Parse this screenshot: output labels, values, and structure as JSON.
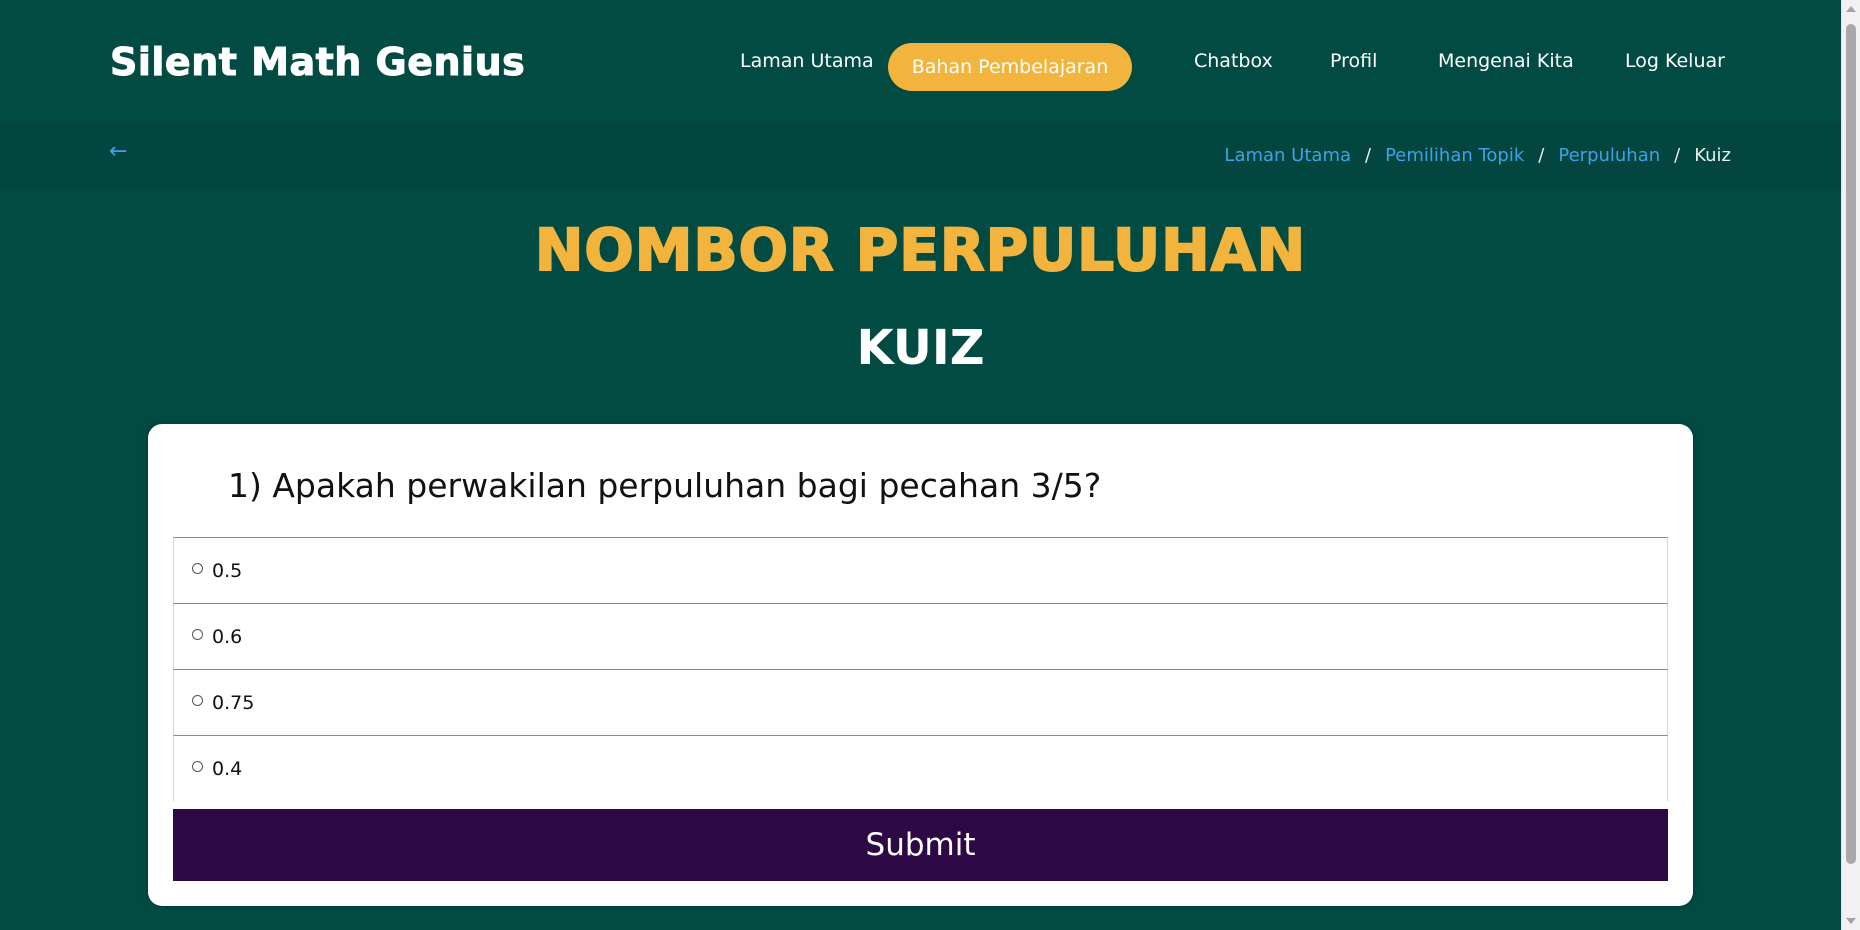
{
  "brand": "Silent Math Genius",
  "nav": {
    "home": "Laman Utama",
    "learning": "Bahan Pembelajaran",
    "chatbox": "Chatbox",
    "profile": "Profil",
    "about": "Mengenai Kita",
    "logout": "Log Keluar"
  },
  "breadcrumb": {
    "back_icon": "←",
    "items": [
      "Laman Utama",
      "Pemilihan Topik",
      "Perpuluhan"
    ],
    "separator": "/",
    "current": "Kuiz"
  },
  "title": "NOMBOR PERPULUHAN",
  "subtitle": "KUIZ",
  "quiz": {
    "question": "1) Apakah perwakilan perpuluhan bagi pecahan 3/5?",
    "options": [
      "0.5",
      "0.6",
      "0.75",
      "0.4"
    ],
    "submit_label": "Submit"
  },
  "colors": {
    "background": "#024b43",
    "accent": "#f2b43c",
    "link": "#3ea2e6",
    "submit": "#2e0844"
  }
}
